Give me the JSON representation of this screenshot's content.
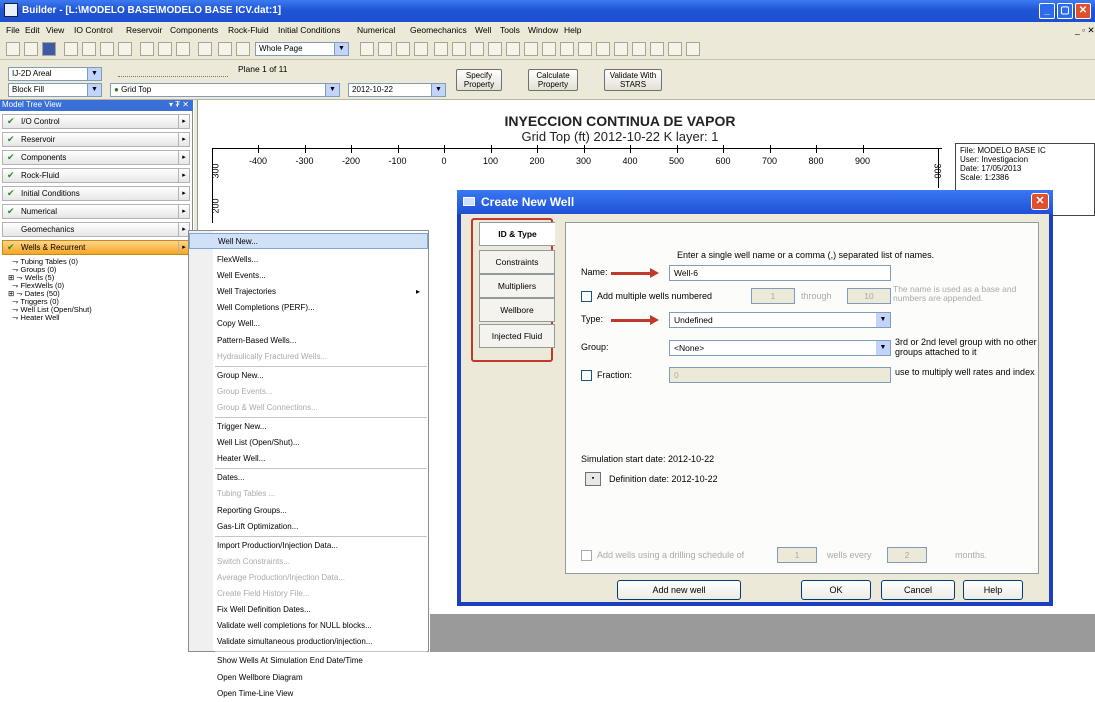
{
  "title": "Builder - [L:\\MODELO BASE\\MODELO BASE ICV.dat:1]",
  "menu": [
    "File",
    "Edit",
    "View",
    "IO Control",
    "Reservoir",
    "Components",
    "Rock-Fluid",
    "Initial Conditions",
    "Numerical",
    "Geomechanics",
    "Well",
    "Tools",
    "Window",
    "Help"
  ],
  "toolbar": {
    "zoom": "Whole Page"
  },
  "toolbar2": {
    "view_mode": "IJ-2D Areal",
    "plane": "Plane 1 of 11",
    "fill": "Block Fill",
    "property": "Grid Top",
    "date": "2012-10-22",
    "specify": "Specify Property",
    "calculate": "Calculate Property",
    "validate": "Validate With STARS"
  },
  "tree": {
    "title": "Model Tree View",
    "nodes": [
      "I/O Control",
      "Reservoir",
      "Components",
      "Rock-Fluid",
      "Initial Conditions",
      "Numerical",
      "Geomechanics",
      "Wells & Recurrent"
    ],
    "sub": [
      "Tubing Tables (0)",
      "Groups (0)",
      "Wells (5)",
      "FlexWells (0)",
      "Dates (50)",
      "Triggers (0)",
      "Well List (Open/Shut)",
      "Heater Well"
    ]
  },
  "plot": {
    "title": "INYECCION CONTINUA DE VAPOR",
    "subtitle": "Grid Top (ft) 2012-10-22    K layer: 1",
    "xticks": [
      "-400",
      "-300",
      "-200",
      "-100",
      "0",
      "100",
      "200",
      "300",
      "400",
      "500",
      "600",
      "700",
      "800",
      "900"
    ],
    "yticks": [
      "300",
      "200"
    ],
    "yticks_right": [
      "300"
    ],
    "info": [
      "File: MODELO BASE IC",
      "User: Investigacion",
      "Date: 17/05/2013",
      "Scale: 1:2386"
    ]
  },
  "menu_ctx": [
    {
      "l": "Well New...",
      "s": "sel"
    },
    {
      "l": "FlexWells..."
    },
    {
      "l": "Well Events..."
    },
    {
      "l": "Well Trajectories",
      "sub": true
    },
    {
      "l": "Well Completions (PERF)..."
    },
    {
      "l": "Copy Well..."
    },
    {
      "l": "Pattern-Based Wells..."
    },
    {
      "l": "Hydraulically Fractured Wells...",
      "s": "dis"
    },
    {
      "sep": true
    },
    {
      "l": "Group New..."
    },
    {
      "l": "Group Events...",
      "s": "dis"
    },
    {
      "l": "Group & Well Connections...",
      "s": "dis"
    },
    {
      "sep": true
    },
    {
      "l": "Trigger New..."
    },
    {
      "l": "Well List (Open/Shut)..."
    },
    {
      "l": "Heater Well..."
    },
    {
      "sep": true
    },
    {
      "l": "Dates..."
    },
    {
      "l": "Tubing Tables ...",
      "s": "dis"
    },
    {
      "l": "Reporting Groups..."
    },
    {
      "l": "Gas-Lift Optimization..."
    },
    {
      "sep": true
    },
    {
      "l": "Import Production/Injection Data..."
    },
    {
      "l": "Switch Constraints...",
      "s": "dis"
    },
    {
      "l": "Average Production/Injection Data...",
      "s": "dis"
    },
    {
      "l": "Create Field History File...",
      "s": "dis"
    },
    {
      "l": "Fix Well Definition Dates..."
    },
    {
      "l": "Validate well completions for NULL blocks..."
    },
    {
      "l": "Validate simultaneous production/injection..."
    },
    {
      "sep": true
    },
    {
      "l": "Show Wells At Simulation End Date/Time"
    },
    {
      "l": "Open Wellbore Diagram"
    },
    {
      "l": "Open Time-Line View"
    }
  ],
  "dialog": {
    "title": "Create New Well",
    "tabs": [
      "ID & Type",
      "Constraints",
      "Multipliers",
      "Wellbore",
      "Injected Fluid"
    ],
    "hint": "Enter a single well name or a comma (,) separated list of names.",
    "name_label": "Name:",
    "name_value": "Well-6",
    "multi_label": "Add multiple wells numbered",
    "multi_from": "1",
    "through": "through",
    "multi_to": "10",
    "multi_note": "The name is used as a base and numbers are appended.",
    "type_label": "Type:",
    "type_value": "Undefined",
    "group_label": "Group:",
    "group_value": "<None>",
    "group_note": "3rd or 2nd level group with no other groups attached to it",
    "fraction_label": "Fraction:",
    "fraction_value": "0",
    "fraction_note": "use to multiply well rates and index",
    "sim_start": "Simulation start date: 2012-10-22",
    "def_date": "Definition date: 2012-10-22",
    "drill_label": "Add wells using a drilling schedule of",
    "drill_n": "1",
    "wells_every": "wells every",
    "drill_m": "2",
    "months": "months.",
    "add_btn": "Add new well",
    "ok": "OK",
    "cancel": "Cancel",
    "help": "Help"
  }
}
